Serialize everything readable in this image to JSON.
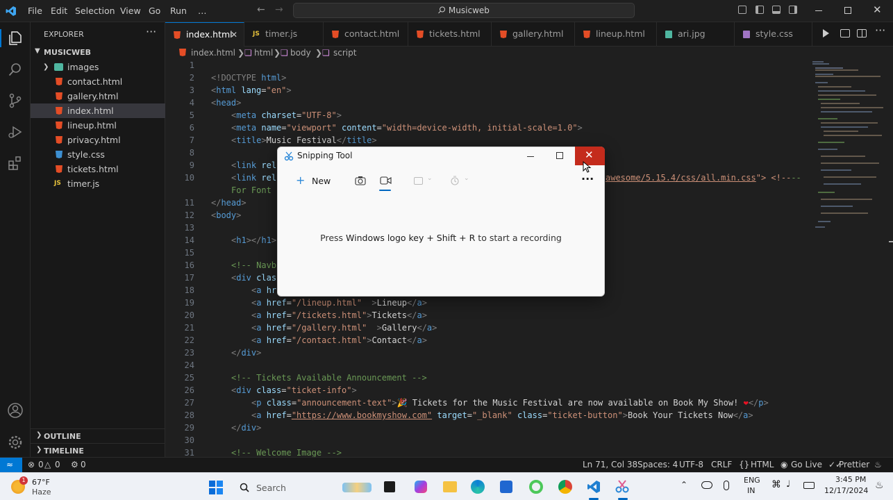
{
  "menu": [
    "File",
    "Edit",
    "Selection",
    "View",
    "Go",
    "Run",
    "…"
  ],
  "search_text": "Musicweb",
  "explorer": {
    "title": "EXPLORER",
    "project": "MUSICWEB",
    "items": [
      {
        "label": "images",
        "type": "folder"
      },
      {
        "label": "contact.html",
        "type": "html"
      },
      {
        "label": "gallery.html",
        "type": "html"
      },
      {
        "label": "index.html",
        "type": "html",
        "selected": true
      },
      {
        "label": "lineup.html",
        "type": "html"
      },
      {
        "label": "privacy.html",
        "type": "html"
      },
      {
        "label": "style.css",
        "type": "css"
      },
      {
        "label": "tickets.html",
        "type": "html"
      },
      {
        "label": "timer.js",
        "type": "js"
      }
    ],
    "outline": "OUTLINE",
    "timeline": "TIMELINE"
  },
  "tabs": [
    {
      "label": "index.html",
      "type": "html",
      "active": true
    },
    {
      "label": "timer.js",
      "type": "js"
    },
    {
      "label": "contact.html",
      "type": "html"
    },
    {
      "label": "tickets.html",
      "type": "html"
    },
    {
      "label": "gallery.html",
      "type": "html"
    },
    {
      "label": "lineup.html",
      "type": "html"
    },
    {
      "label": "ari.jpg",
      "type": "img"
    },
    {
      "label": "style.css",
      "type": "css"
    }
  ],
  "breadcrumb": [
    "index.html",
    "html",
    "body",
    "script"
  ],
  "line_numbers": [
    "1",
    "2",
    "3",
    "4",
    "5",
    "6",
    "7",
    "8",
    "9",
    "10",
    "",
    "11",
    "12",
    "13",
    "14",
    "15",
    "16",
    "17",
    "18",
    "19",
    "20",
    "21",
    "22",
    "23",
    "24",
    "25",
    "26",
    "27",
    "28",
    "29",
    "30",
    "31"
  ],
  "code": {
    "l2": [
      "<!DOCTYPE ",
      "html",
      ">"
    ],
    "l3": [
      "<",
      "html",
      " lang",
      "=",
      "\"en\"",
      ">"
    ],
    "l4": [
      "<",
      "head",
      ">"
    ],
    "l5": [
      "<",
      "meta",
      " charset",
      "=",
      "\"UTF-8\"",
      ">"
    ],
    "l6": [
      "<",
      "meta",
      " name",
      "=",
      "\"viewport\"",
      " content",
      "=",
      "\"width=device-width, initial-scale=1.0\"",
      ">"
    ],
    "l7": [
      "<",
      "title",
      ">",
      "Music Festival",
      "</",
      "title",
      ">"
    ],
    "l9": [
      "<",
      "link",
      " rel"
    ],
    "l10a": [
      "<",
      "link",
      " rel"
    ],
    "l10b": "awesome/5.15.4/css/all.min.css",
    "l10c": "\"> <!--",
    "l10d": "For Font",
    "l11": [
      "</",
      "head",
      ">"
    ],
    "l12": [
      "<",
      "body",
      ">"
    ],
    "l14": [
      "<",
      "h1",
      "></",
      "h1",
      ">"
    ],
    "l16": "<!-- Navb",
    "l17": [
      "<",
      "div",
      " clas"
    ],
    "l18": [
      "<",
      "a",
      " hr"
    ],
    "l19": [
      "<",
      "a",
      " href",
      "=",
      "\"/lineup.html\"",
      "  >",
      "Lineup",
      "</",
      "a",
      ">"
    ],
    "l20": [
      "<",
      "a",
      " href",
      "=",
      "\"/tickets.html\"",
      ">",
      "Tickets",
      "</",
      "a",
      ">"
    ],
    "l21": [
      "<",
      "a",
      " href",
      "=",
      "\"/gallery.html\"",
      "  >",
      "Gallery",
      "</",
      "a",
      ">"
    ],
    "l22": [
      "<",
      "a",
      " href",
      "=",
      "\"/contact.html\"",
      ">",
      "Contact",
      "</",
      "a",
      ">"
    ],
    "l23": [
      "</",
      "div",
      ">"
    ],
    "l25": "<!-- Tickets Available Announcement -->",
    "l26": [
      "<",
      "div",
      " class",
      "=",
      "\"ticket-info\"",
      ">"
    ],
    "l27": [
      "<",
      "p",
      " class",
      "=",
      "\"announcement-text\"",
      ">",
      "🎉 Tickets for the Music Festival are now available on Book My Show! ",
      "❤",
      "</",
      "p",
      ">"
    ],
    "l28": [
      "<",
      "a",
      " href",
      "=",
      "\"https://www.bookmyshow.com\"",
      " target",
      "=",
      "\"_blank\"",
      " class",
      "=",
      "\"ticket-button\"",
      ">",
      "Book Your Tickets Now",
      "</",
      "a",
      ">"
    ],
    "l29": [
      "</",
      "div",
      ">"
    ],
    "l31": "<!-- Welcome Image -->"
  },
  "snipping_tool": {
    "title": "Snipping Tool",
    "new_label": "New",
    "message_prefix": "Press ",
    "message_keys": "Windows logo key + Shift + R",
    "message_suffix": " to start a recording"
  },
  "status": {
    "errors": "0",
    "warnings": "0",
    "ports": "0",
    "cursor": "Ln 71, Col 38",
    "spaces": "Spaces: 4",
    "encoding": "UTF-8",
    "eol": "CRLF",
    "language": "HTML",
    "golive": "Go Live",
    "prettier": "Prettier"
  },
  "taskbar": {
    "weather_temp": "67°F",
    "weather_desc": "Haze",
    "weather_badge": "1",
    "search_placeholder": "Search",
    "lang_top": "ENG",
    "lang_bottom": "IN",
    "time": "3:45 PM",
    "date": "12/17/2024"
  },
  "colors": {
    "accent": "#0078d4",
    "close_red": "#c42b1c",
    "html_icon": "#e44d26",
    "css_icon": "#3d8fd1",
    "js_icon": "#e8c33c"
  }
}
